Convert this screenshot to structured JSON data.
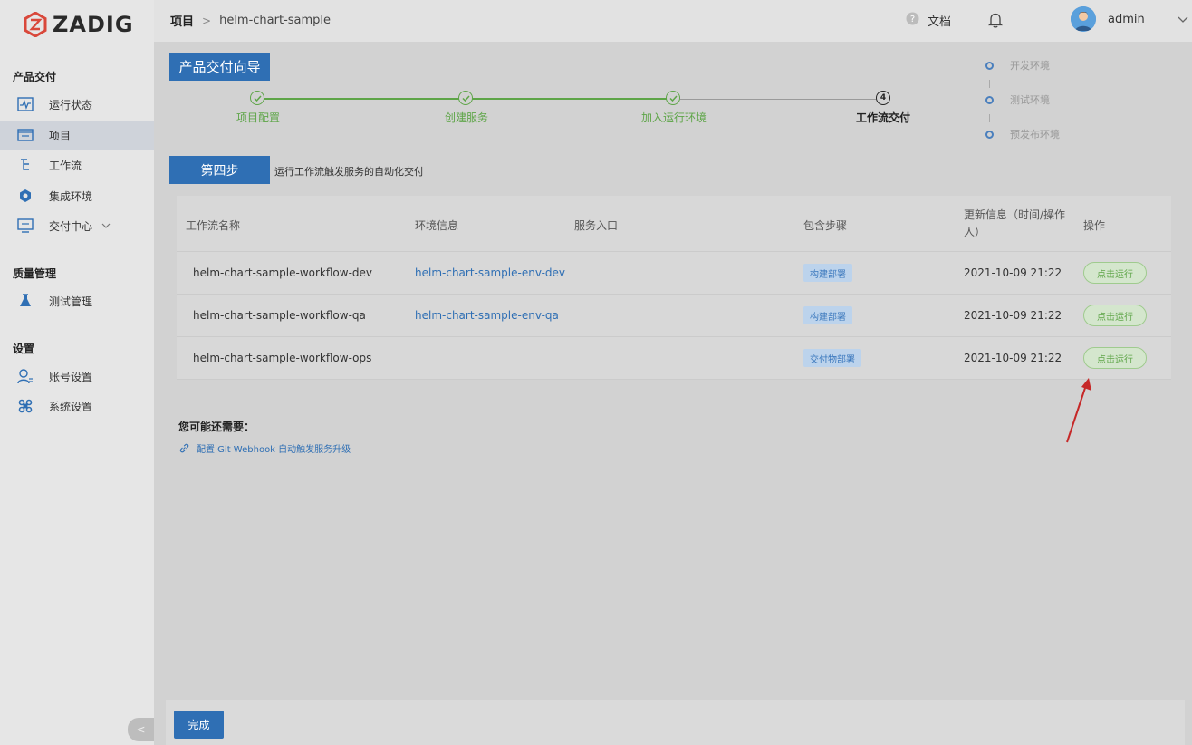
{
  "sidebar": {
    "logo_text": "ZADIG",
    "sections": [
      {
        "title": "产品交付"
      },
      {
        "title": "质量管理"
      },
      {
        "title": "设置"
      }
    ],
    "items": [
      {
        "label": "运行状态",
        "icon": "status-monitor-icon"
      },
      {
        "label": "项目",
        "icon": "project-icon"
      },
      {
        "label": "工作流",
        "icon": "workflow-icon"
      },
      {
        "label": "集成环境",
        "icon": "environment-icon"
      },
      {
        "label": "交付中心",
        "icon": "delivery-center-icon"
      },
      {
        "label": "测试管理",
        "icon": "test-flask-icon"
      },
      {
        "label": "账号设置",
        "icon": "user-settings-icon"
      },
      {
        "label": "系统设置",
        "icon": "system-settings-icon"
      }
    ],
    "collapse_label": "<"
  },
  "header": {
    "breadcrumb_root": "项目",
    "breadcrumb_sep": ">",
    "breadcrumb_current": "helm-chart-sample",
    "docs_label": "文档",
    "user_name": "admin"
  },
  "guide": {
    "title": "产品交付向导",
    "steps": [
      {
        "label": "项目配置",
        "done": true
      },
      {
        "label": "创建服务",
        "done": true
      },
      {
        "label": "加入运行环境",
        "done": true
      },
      {
        "label": "工作流交付",
        "done": false,
        "number": "4"
      }
    ],
    "envs": [
      "开发环境",
      "测试环境",
      "预发布环境"
    ]
  },
  "step4": {
    "button": "第四步",
    "description": "运行工作流触发服务的自动化交付"
  },
  "table": {
    "headers": {
      "name": "工作流名称",
      "env": "环境信息",
      "entry": "服务入口",
      "steps": "包含步骤",
      "update": "更新信息（时间/操作人）",
      "action": "操作"
    },
    "rows": [
      {
        "name": "helm-chart-sample-workflow-dev",
        "env": "helm-chart-sample-env-dev",
        "tag": "构建部署",
        "time": "2021-10-09 21:22",
        "action": "点击运行"
      },
      {
        "name": "helm-chart-sample-workflow-qa",
        "env": "helm-chart-sample-env-qa",
        "tag": "构建部署",
        "time": "2021-10-09 21:22",
        "action": "点击运行"
      },
      {
        "name": "helm-chart-sample-workflow-ops",
        "env": "",
        "tag": "交付物部署",
        "time": "2021-10-09 21:22",
        "action": "点击运行"
      }
    ]
  },
  "tips": {
    "title": "您可能还需要：",
    "link": "配置 Git Webhook 自动触发服务升级"
  },
  "footer": {
    "done_label": "完成"
  },
  "colors": {
    "primary": "#2f6fb4",
    "success": "#5ea548",
    "annotation": "#c62828"
  }
}
